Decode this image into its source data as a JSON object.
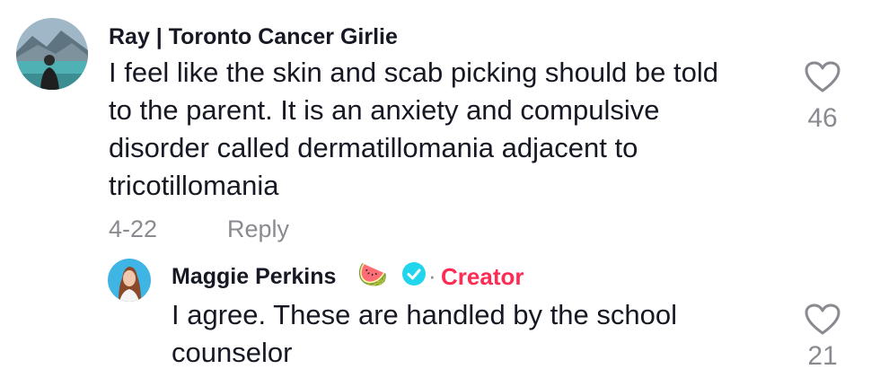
{
  "comment": {
    "username": "Ray | Toronto Cancer Girlie",
    "lines": [
      "I feel like the skin and scab picking should be told",
      "to the parent. It is an anxiety and compulsive",
      "disorder called dermatillomania adjacent to",
      "tricotillomania"
    ],
    "date": "4-22",
    "reply_label": "Reply",
    "like_count": "46",
    "like_icon": "heart-outline-icon"
  },
  "reply": {
    "username": "Maggie Perkins",
    "emoji": "🍉",
    "verified_icon": "verified-check-icon",
    "separator": "·",
    "creator_label": "Creator",
    "lines": [
      "I agree. These are handled by the school",
      "counselor"
    ],
    "like_count": "21",
    "like_icon": "heart-outline-icon"
  },
  "colors": {
    "creator": "#fe2c55",
    "verified": "#20d5ec",
    "muted": "#8a8b91"
  }
}
